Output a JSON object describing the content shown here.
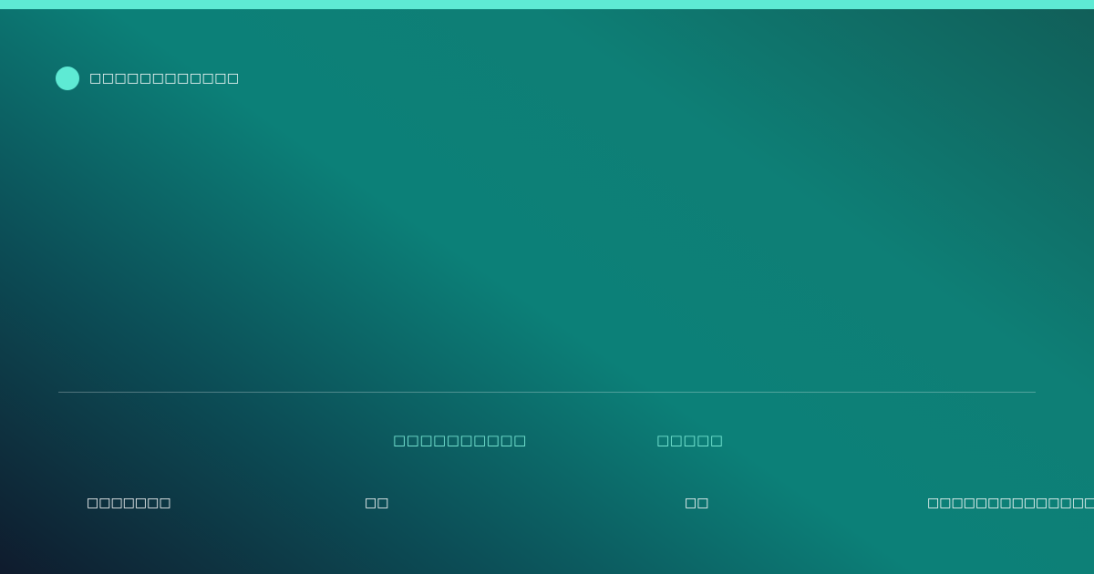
{
  "brand": {
    "name": "□□□□□□□□□□□□"
  },
  "meta": {
    "label_1": "□□□□□□□□□□",
    "label_2": "□□□□□"
  },
  "footer": {
    "item_1": "□□□□□□□",
    "item_2": "□□",
    "item_3": "□□",
    "item_4": "□□□□□□□□□□□□□□□□"
  },
  "colors": {
    "accent": "#5eead4",
    "background_start": "#0f1b2d",
    "background_mid": "#0c8078",
    "background_end": "#115e58"
  }
}
